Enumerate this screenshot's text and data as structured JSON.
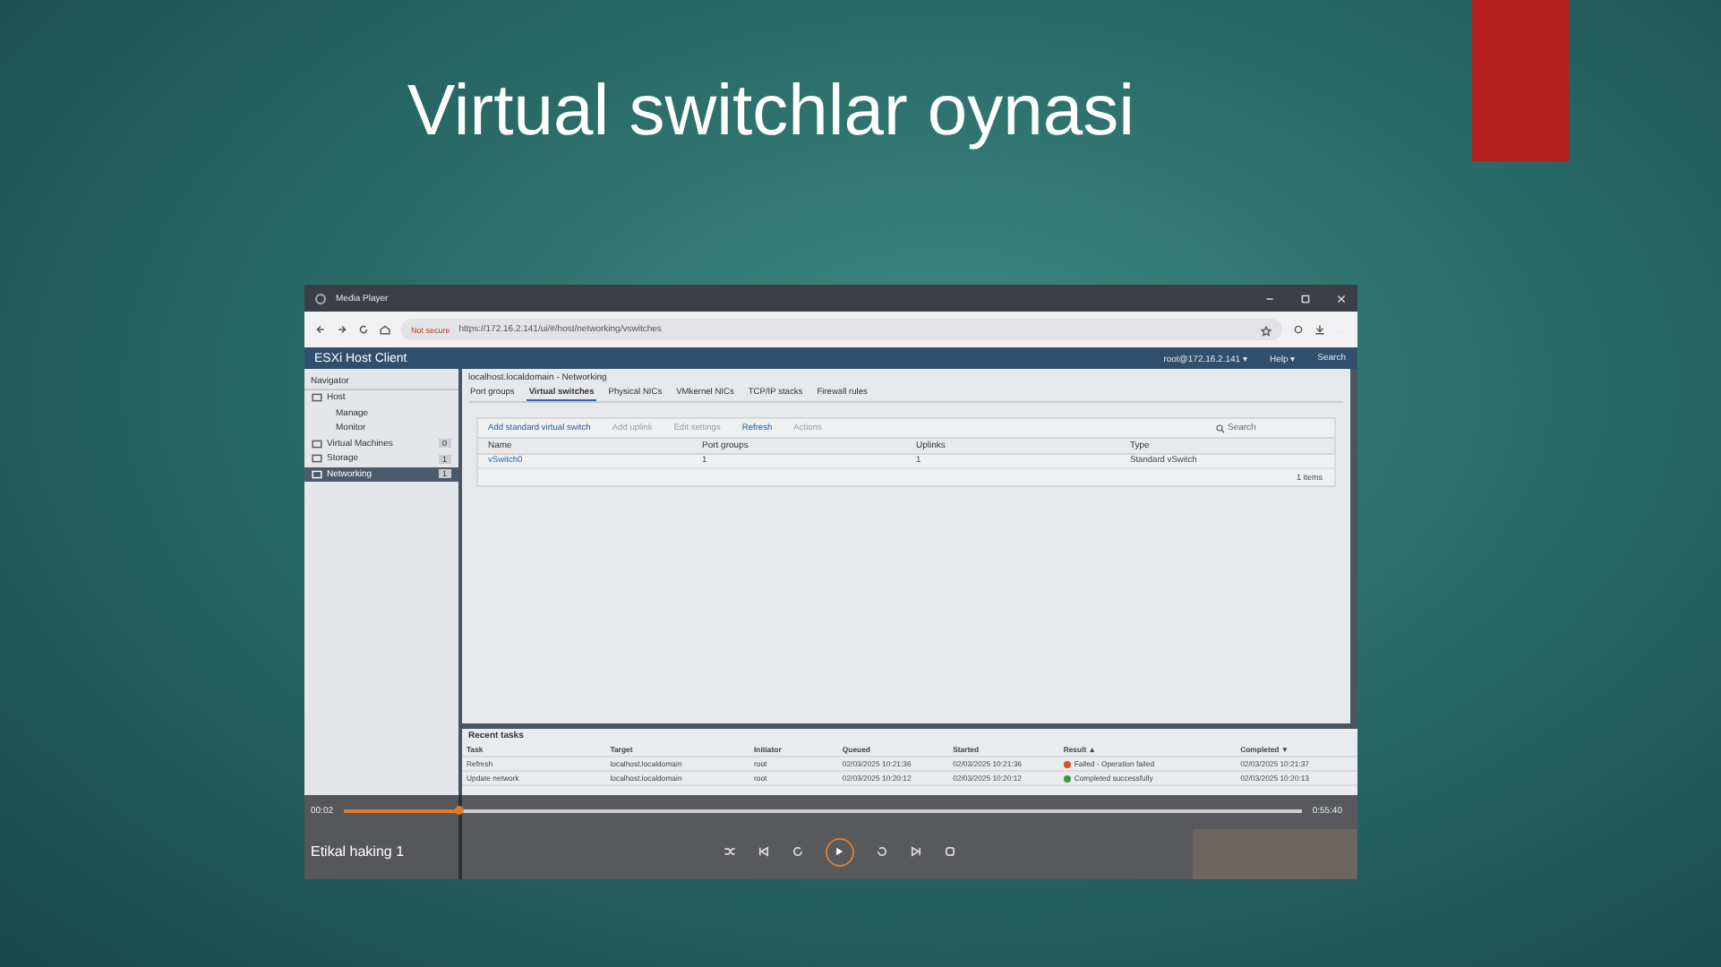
{
  "slide": {
    "title": "Virtual switchlar oynasi"
  },
  "player": {
    "app_title": "Media Player",
    "video_title": "Etikal haking 1",
    "elapsed": "00:02",
    "total": "0:55:40",
    "level": 0.12
  },
  "browser": {
    "security": "Not secure",
    "url": "https://172.16.2.141/ui/#/host/networking/vswitches"
  },
  "esxi": {
    "app_title": "ESXi Host Client",
    "user": "root@172.16.2.141 ▾",
    "help": "Help ▾",
    "search": "Search",
    "table_search": "Search",
    "navigator": {
      "title": "Navigator",
      "items": [
        {
          "label": "Host",
          "selected": false,
          "children": [
            {
              "label": "Manage",
              "selected": false
            },
            {
              "label": "Monitor",
              "selected": false
            }
          ]
        },
        {
          "label": "Virtual Machines",
          "badge": "0",
          "selected": false
        },
        {
          "label": "Storage",
          "badge": "1",
          "selected": false
        },
        {
          "label": "Networking",
          "badge": "1",
          "selected": true
        }
      ]
    },
    "page_title": "localhost.localdomain - Networking",
    "tabs": [
      {
        "label": "Port groups",
        "selected": false
      },
      {
        "label": "Virtual switches",
        "selected": true
      },
      {
        "label": "Physical NICs",
        "selected": false
      },
      {
        "label": "VMkernel NICs",
        "selected": false
      },
      {
        "label": "TCP/IP stacks",
        "selected": false
      },
      {
        "label": "Firewall rules",
        "selected": false
      }
    ],
    "toolbar": [
      {
        "label": "Add standard virtual switch",
        "disabled": false
      },
      {
        "label": "Add uplink",
        "disabled": true
      },
      {
        "label": "Edit settings",
        "disabled": true
      },
      {
        "label": "Refresh",
        "disabled": false
      },
      {
        "label": "Actions",
        "disabled": true
      }
    ],
    "table": {
      "columns": [
        "Name",
        "Port groups",
        "Uplinks",
        "Type"
      ],
      "rows": [
        [
          "vSwitch0",
          "1",
          "1",
          "Standard vSwitch"
        ]
      ]
    },
    "item_count": "1 items",
    "recent_tasks": {
      "title": "Recent tasks",
      "columns": [
        "Task",
        "Target",
        "Initiator",
        "Queued",
        "Started",
        "Result ▲",
        "Completed ▼"
      ],
      "rows": [
        {
          "cells": [
            "Refresh",
            "localhost.localdomain",
            "root",
            "02/03/2025 10:21:36",
            "02/03/2025 10:21:36",
            "Failed - Operation failed",
            "02/03/2025 10:21:37"
          ],
          "color": "#d9532c"
        },
        {
          "cells": [
            "Update network",
            "localhost.localdomain",
            "root",
            "02/03/2025 10:20:12",
            "02/03/2025 10:20:12",
            "Completed successfully",
            "02/03/2025 10:20:13"
          ],
          "color": "#3a9a3a"
        }
      ]
    }
  }
}
